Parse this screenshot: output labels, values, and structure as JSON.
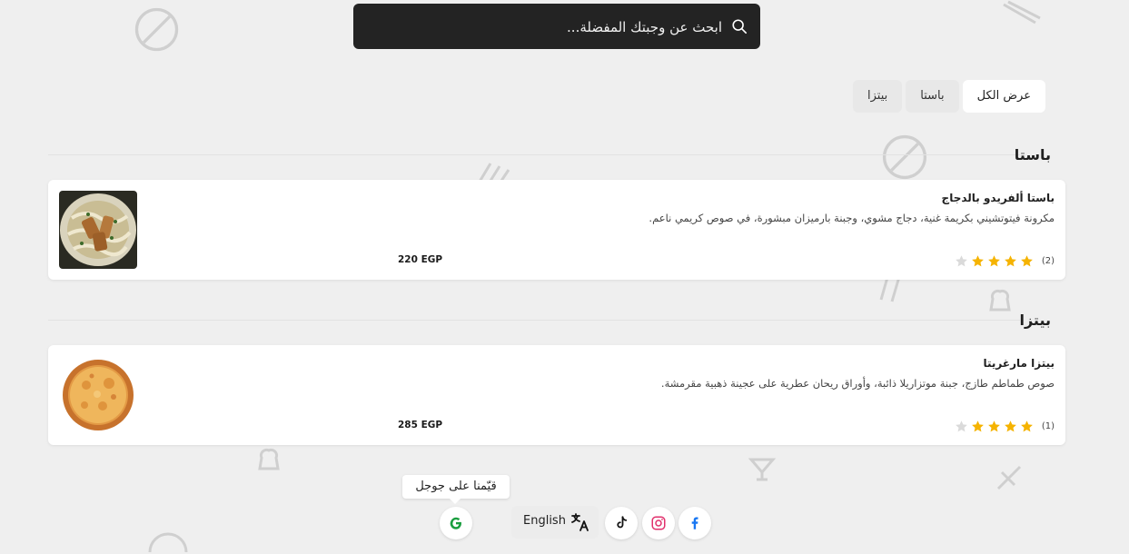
{
  "search": {
    "placeholder": "ابحث عن وجبتك المفضلة..."
  },
  "categories": {
    "items": [
      {
        "label": "عرض الكل",
        "active": true
      },
      {
        "label": "باستا",
        "active": false
      },
      {
        "label": "بيتزا",
        "active": false
      }
    ]
  },
  "sections": [
    {
      "title": "باستا",
      "items": [
        {
          "name": "باستا ألفريدو بالدجاج",
          "description": "مكرونة فيتوتشيني بكريمة غنية، دجاج مشوي، وجبنة بارميزان مبشورة، في صوص كريمي ناعم.",
          "price": "220 EGP",
          "rating_count": "(2)",
          "stars": 4
        }
      ]
    },
    {
      "title": "بيتزا",
      "items": [
        {
          "name": "بيتزا مارغريتا",
          "description": "صوص طماطم طازج، جبنة موتزاريلا ذائبة، وأوراق ريحان عطرية على عجينة ذهبية مقرمشة.",
          "price": "285 EGP",
          "rating_count": "(1)",
          "stars": 4
        }
      ]
    }
  ],
  "footer": {
    "google_tooltip": "قيّمنا على جوجل",
    "language_label": "English",
    "socials": [
      "facebook-icon",
      "instagram-icon",
      "tiktok-icon"
    ]
  },
  "colors": {
    "star": "#f5b301",
    "star_empty": "#dadada",
    "search_bg": "#232323",
    "page_bg": "#efefef"
  }
}
